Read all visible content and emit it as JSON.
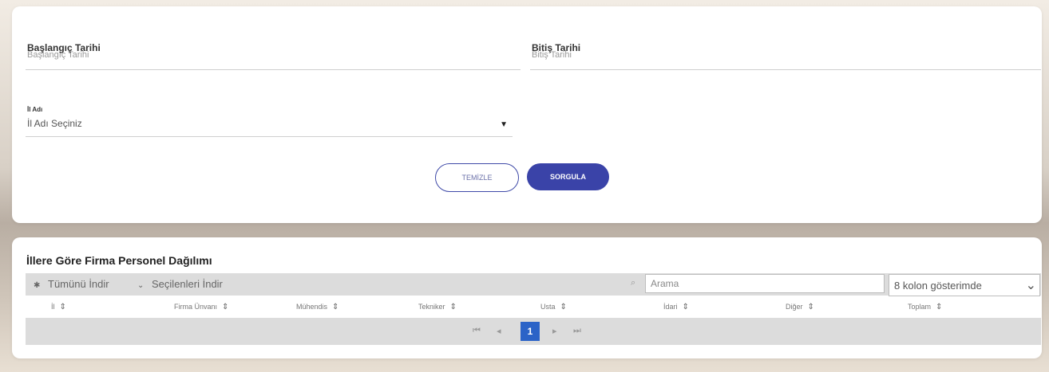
{
  "filters": {
    "start_date": {
      "label": "Başlangıç Tarihi",
      "placeholder": "Başlangıç Tarihi"
    },
    "end_date": {
      "label": "Bitiş Tarihi",
      "placeholder": "Bitiş Tarihi"
    },
    "province": {
      "label": "İl Adı",
      "placeholder": "İl Adı Seçiniz"
    },
    "clear_label": "TEMİZLE",
    "query_label": "SORGULA"
  },
  "report": {
    "title": "İllere Göre Firma Personel Dağılımı",
    "download_all": "Tümünü İndir",
    "download_selected": "Seçilenleri İndir",
    "search_placeholder": "Arama",
    "columns_label": "8 kolon gösterimde",
    "columns": [
      "İl",
      "Firma Ünvanı",
      "Mühendis",
      "Tekniker",
      "Usta",
      "İdari",
      "Diğer",
      "Toplam"
    ],
    "pagination": {
      "current_page": "1"
    }
  },
  "colors": {
    "accent": "#3a43a8",
    "page_active": "#2b63c7"
  }
}
